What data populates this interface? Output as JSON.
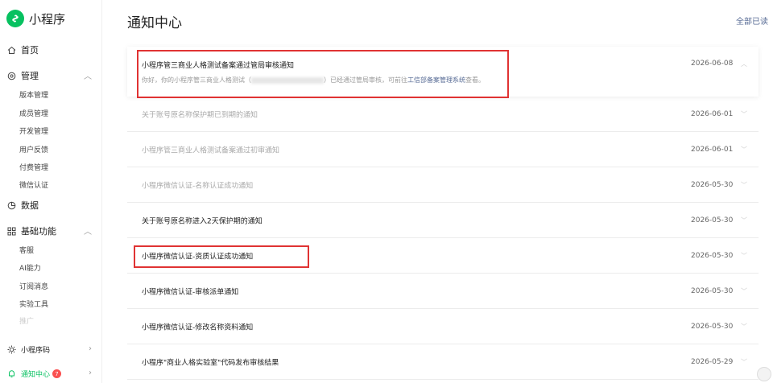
{
  "app": {
    "name": "小程序"
  },
  "sidebar": {
    "home": "首页",
    "manage": {
      "label": "管理",
      "items": [
        "版本管理",
        "成员管理",
        "开发管理",
        "用户反馈",
        "付费管理",
        "微信认证"
      ]
    },
    "data": "数据",
    "basic": {
      "label": "基础功能",
      "items": [
        "客服",
        "AI能力",
        "订阅消息",
        "实验工具",
        "推广"
      ]
    },
    "qrcode": "小程序码",
    "notify": {
      "label": "通知中心",
      "badge": "7"
    }
  },
  "page": {
    "title": "通知中心",
    "mark_all_read": "全部已读"
  },
  "notifications": [
    {
      "title": "小程序管三商业人格测试备案通过管局审核通知",
      "date": "2026-06-08",
      "desc_before": "你好，你的小程序管三商业人格测试（",
      "desc_after": "）已经通过管局审核，可前往",
      "desc_link": "工信部备案管理系统",
      "desc_end": "查看。"
    },
    {
      "title": "关于账号原名称保护期已到期的通知",
      "date": "2026-06-01"
    },
    {
      "title": "小程序管三商业人格测试备案通过初审通知",
      "date": "2026-06-01"
    },
    {
      "title": "小程序微信认证-名称认证成功通知",
      "date": "2026-05-30"
    },
    {
      "title": "关于账号原名称进入2天保护期的通知",
      "date": "2026-05-30"
    },
    {
      "title": "小程序微信认证-资质认证成功通知",
      "date": "2026-05-30"
    },
    {
      "title": "小程序微信认证-审核派单通知",
      "date": "2026-05-30"
    },
    {
      "title": "小程序微信认证-修改名称资料通知",
      "date": "2026-05-30"
    },
    {
      "title": "小程序\"商业人格实验室\"代码发布审核结果",
      "date": "2026-05-29"
    }
  ],
  "colors": {
    "brand": "#07c160",
    "highlight": "#e03333",
    "link": "#576b95",
    "badge": "#fa5151"
  }
}
